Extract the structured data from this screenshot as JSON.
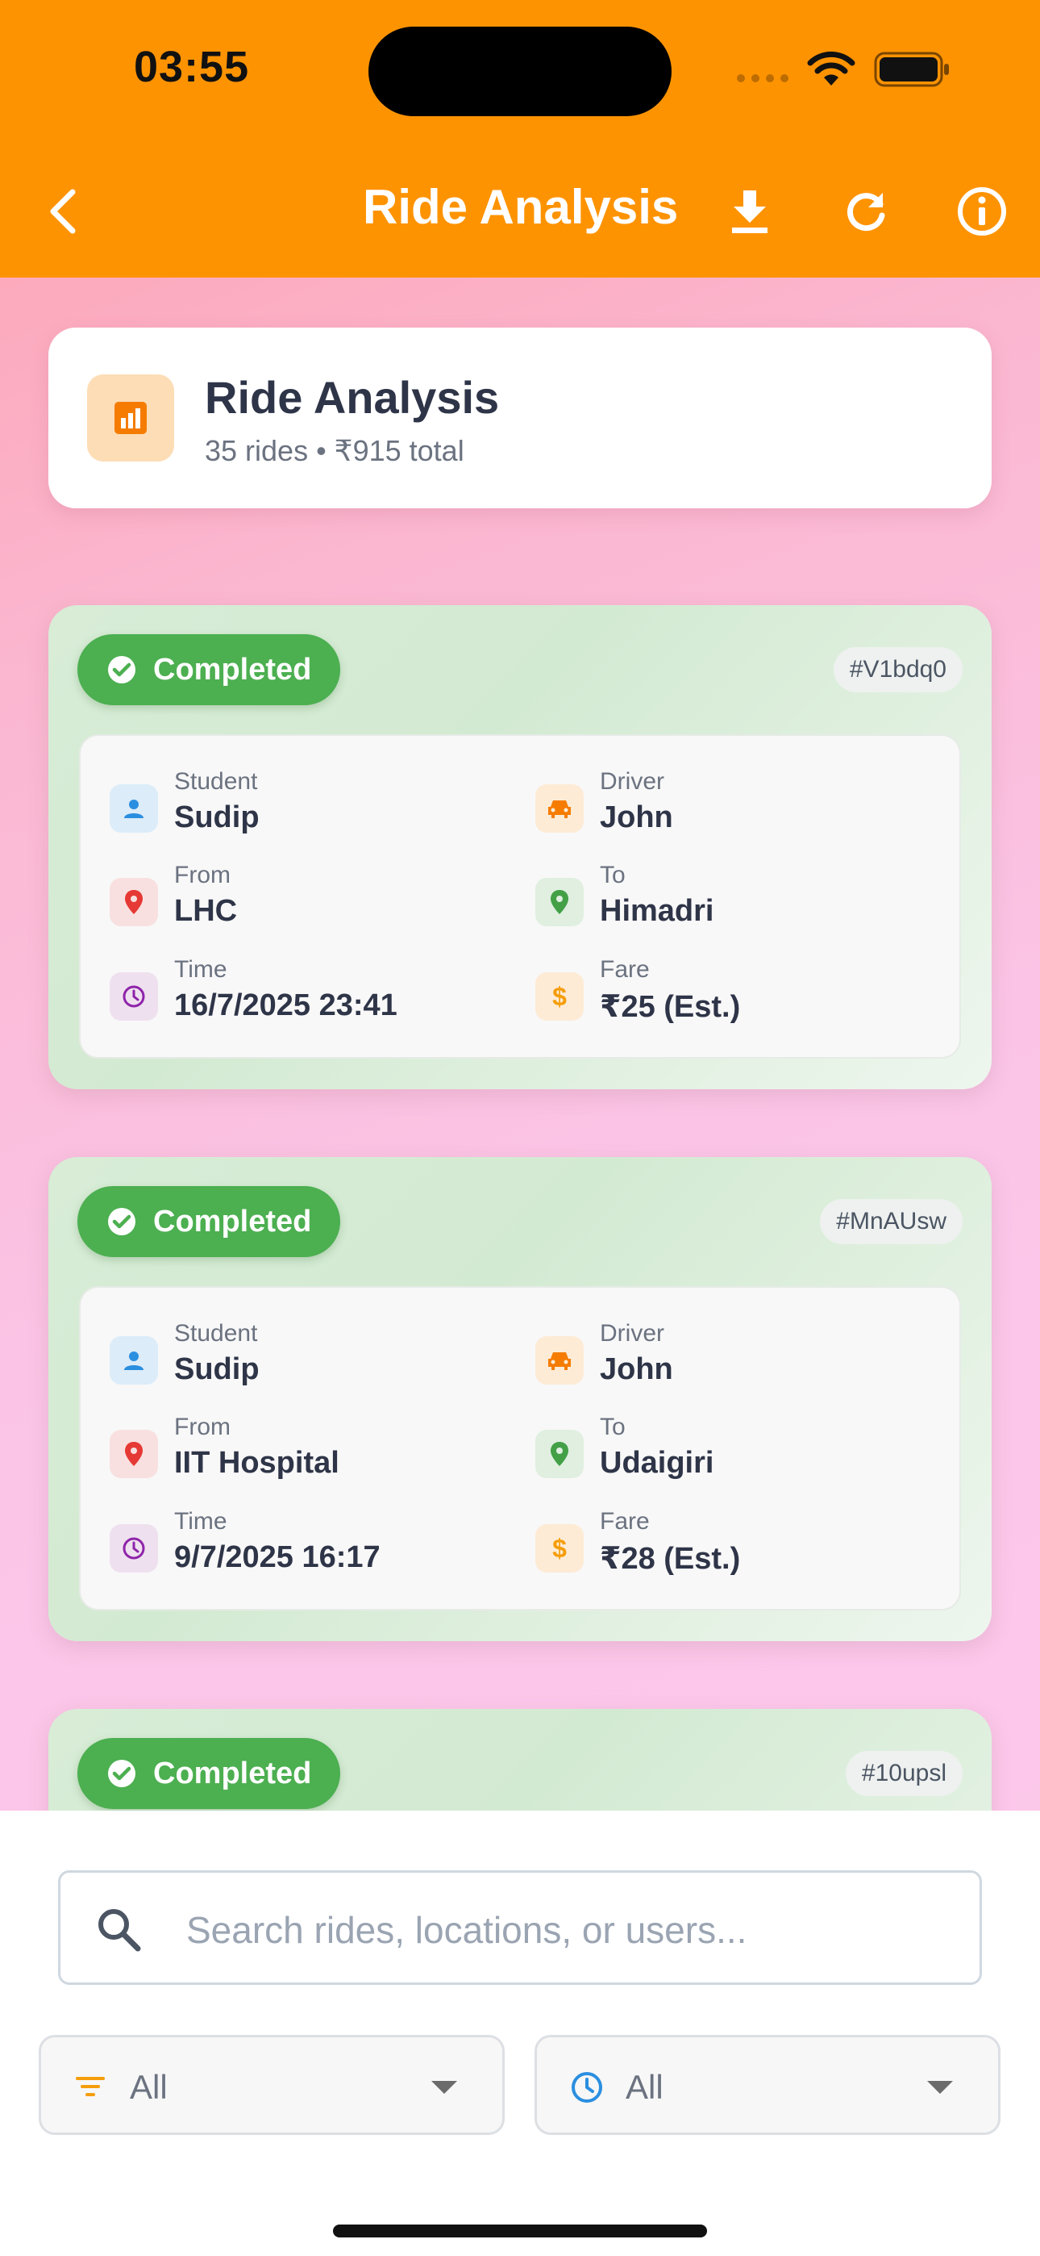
{
  "status_bar": {
    "time": "03:55"
  },
  "appbar": {
    "title": "Ride Analysis",
    "back_icon": "chevron-left-icon",
    "actions": [
      "download-icon",
      "refresh-icon",
      "info-icon"
    ]
  },
  "summary": {
    "title": "Ride Analysis",
    "subtitle": "35 rides • ₹915 total",
    "icon": "analytics-icon"
  },
  "labels": {
    "student": "Student",
    "driver": "Driver",
    "from": "From",
    "to": "To",
    "time": "Time",
    "fare": "Fare"
  },
  "rides": [
    {
      "status": "Completed",
      "id": "#V1bdq0",
      "student": "Sudip",
      "driver": "John",
      "from": "LHC",
      "to": "Himadri",
      "time": "16/7/2025 23:41",
      "fare": "₹25 (Est.)"
    },
    {
      "status": "Completed",
      "id": "#MnAUsw",
      "student": "Sudip",
      "driver": "John",
      "from": "IIT Hospital",
      "to": "Udaigiri",
      "time": "9/7/2025 16:17",
      "fare": "₹28 (Est.)"
    },
    {
      "status": "Completed",
      "id": "#10upsl"
    }
  ],
  "search": {
    "placeholder": "Search rides, locations, or users...",
    "value": ""
  },
  "filters": {
    "status": {
      "value": "All",
      "icon": "filter-icon"
    },
    "time": {
      "value": "All",
      "icon": "clock-icon"
    }
  },
  "colors": {
    "appbar": "#fe9302",
    "completed": "#4caf50",
    "accent": "#f59e0b"
  }
}
